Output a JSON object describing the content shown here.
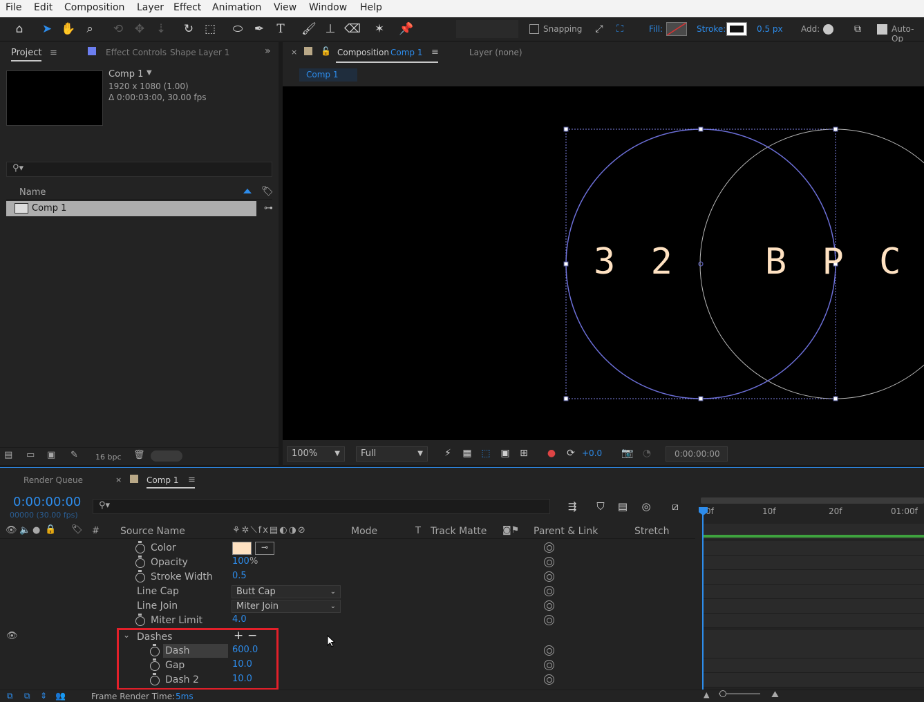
{
  "menu": [
    "File",
    "Edit",
    "Composition",
    "Layer",
    "Effect",
    "Animation",
    "View",
    "Window",
    "Help"
  ],
  "toolbar": {
    "snapping_label": "Snapping",
    "fill_label": "Fill:",
    "stroke_label": "Stroke:",
    "stroke_width": "0.5 px",
    "add_label": "Add:",
    "auto_open_label": "Auto-Op"
  },
  "project_panel": {
    "tab_label": "Project",
    "effect_controls_label": "Effect Controls",
    "effect_controls_layer": "Shape Layer 1",
    "comp_name": "Comp 1",
    "comp_resolution": "1920 x 1080 (1.00)",
    "comp_duration": "Δ 0:00:03:00, 30.00 fps",
    "name_header": "Name",
    "items": [
      {
        "name": "Comp 1"
      }
    ],
    "bpc": "16 bpc"
  },
  "viewer": {
    "tab_prefix": "Composition",
    "tab_comp": "Comp 1",
    "layer_tab": "Layer (none)",
    "breadcrumb": "Comp 1",
    "canvas_text": "3 2   B P C",
    "zoom": "100%",
    "resolution": "Full",
    "exposure": "+0.0",
    "timecode": "0:00:00:00"
  },
  "timeline": {
    "render_queue_tab": "Render Queue",
    "comp_tab": "Comp 1",
    "timecode": "0:00:00:00",
    "frame_info": "00000 (30.00 fps)",
    "columns": {
      "hash": "#",
      "source_name": "Source Name",
      "mode": "Mode",
      "t": "T",
      "track_matte": "Track Matte",
      "parent_link": "Parent & Link",
      "stretch": "Stretch"
    },
    "ruler": [
      "0f",
      "10f",
      "20f",
      "01:00f"
    ],
    "properties": [
      {
        "name": "Color",
        "value": ""
      },
      {
        "name": "Opacity",
        "value": "100",
        "unit": "%"
      },
      {
        "name": "Stroke Width",
        "value": "0.5"
      },
      {
        "name": "Line Cap",
        "value": "Butt Cap"
      },
      {
        "name": "Line Join",
        "value": "Miter Join"
      },
      {
        "name": "Miter Limit",
        "value": "4.0"
      },
      {
        "name": "Dashes",
        "value": ""
      },
      {
        "name": "Dash",
        "value": "600.0"
      },
      {
        "name": "Gap",
        "value": "10.0"
      },
      {
        "name": "Dash 2",
        "value": "10.0"
      }
    ],
    "status_label": "Frame Render Time:",
    "status_value": "5ms"
  },
  "colors": {
    "accent": "#2d8ceb",
    "stroke_swatch": "#ffe2c2",
    "highlight_box": "#e3202a",
    "shape_path": "#6c6fd8"
  }
}
